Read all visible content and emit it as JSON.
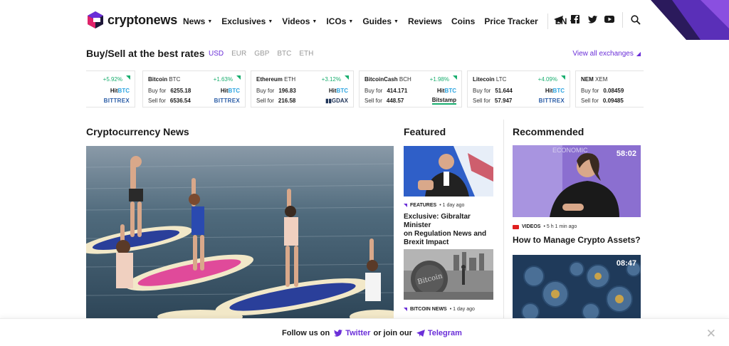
{
  "brand": {
    "name": "cryptonews"
  },
  "nav": {
    "items": [
      {
        "label": "News",
        "dropdown": true
      },
      {
        "label": "Exclusives",
        "dropdown": true
      },
      {
        "label": "Videos",
        "dropdown": true
      },
      {
        "label": "ICOs",
        "dropdown": true
      },
      {
        "label": "Guides",
        "dropdown": true
      },
      {
        "label": "Reviews",
        "dropdown": false
      },
      {
        "label": "Coins",
        "dropdown": false
      },
      {
        "label": "Price Tracker",
        "dropdown": false
      }
    ],
    "language": "EN"
  },
  "social_icons": [
    "telegram-icon",
    "facebook-icon",
    "twitter-icon",
    "youtube-icon",
    "search-icon"
  ],
  "rates": {
    "title": "Buy/Sell at the best rates",
    "currencies": [
      "USD",
      "EUR",
      "GBP",
      "BTC",
      "ETH"
    ],
    "active_currency": "USD",
    "view_all": "View all exchanges",
    "buy_label": "Buy for",
    "sell_label": "Sell for",
    "cards": [
      {
        "name": "",
        "symbol": "",
        "change": "+5.92%",
        "buy": "",
        "sell": "",
        "buy_ex": "HitBTC",
        "sell_ex": "BITTREX"
      },
      {
        "name": "Bitcoin",
        "symbol": "BTC",
        "change": "+1.63%",
        "buy": "6255.18",
        "sell": "6536.54",
        "buy_ex": "HitBTC",
        "sell_ex": "BITTREX"
      },
      {
        "name": "Ethereum",
        "symbol": "ETH",
        "change": "+3.12%",
        "buy": "196.83",
        "sell": "216.58",
        "buy_ex": "HitBTC",
        "sell_ex": "GDAX"
      },
      {
        "name": "BitcoinCash",
        "symbol": "BCH",
        "change": "+1.98%",
        "buy": "414.171",
        "sell": "448.57",
        "buy_ex": "HitBTC",
        "sell_ex": "Bitstamp"
      },
      {
        "name": "Litecoin",
        "symbol": "LTC",
        "change": "+4.09%",
        "buy": "51.644",
        "sell": "57.947",
        "buy_ex": "HitBTC",
        "sell_ex": "BITTREX"
      },
      {
        "name": "NEM",
        "symbol": "XEM",
        "change": "",
        "buy": "0.08459",
        "sell": "0.09485",
        "buy_ex": "",
        "sell_ex": ""
      }
    ]
  },
  "sections": {
    "news_title": "Cryptocurrency News",
    "featured_title": "Featured",
    "recommended_title": "Recommended"
  },
  "featured": [
    {
      "category": "FEATURES",
      "time": "1 day ago",
      "headline_lines": [
        "Exclusive: Gibraltar Minister",
        "on Regulation News and",
        "Brexit Impact"
      ]
    },
    {
      "category": "BITCOIN NEWS",
      "time": "1 day ago",
      "headline_lines": []
    }
  ],
  "featured_image_text": "Bitcoin",
  "recommended": [
    {
      "category": "VIDEOS",
      "time": "5 h 1 min ago",
      "headline": "How to Manage Crypto Assets?",
      "duration": "58:02",
      "backdrop_text": "ECONOMIC"
    },
    {
      "duration": "08:47"
    }
  ],
  "follow_bar": {
    "prefix": "Follow us on",
    "twitter": "Twitter",
    "middle": "or join our",
    "telegram": "Telegram"
  },
  "colors": {
    "accent": "#6b2fd8",
    "positive": "#1aae6f",
    "youtube": "#e02020"
  }
}
